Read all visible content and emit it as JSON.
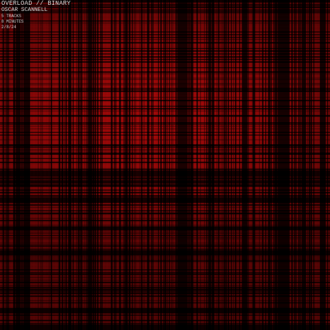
{
  "cover": {
    "title": "OVERLOAD // BINARY",
    "artist": "OSCAR SCANNELL",
    "tracks": "5 TRACKS",
    "duration": "8 MINUTES",
    "date": "2/8/24"
  },
  "palette": {
    "background": "#000000",
    "primary": "#d40c0c",
    "glow": "#ff2a2a",
    "text": "#d8d8d8"
  }
}
